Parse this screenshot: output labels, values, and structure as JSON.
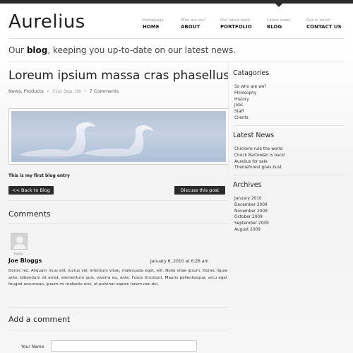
{
  "site": {
    "logo": "Aurelius"
  },
  "nav": [
    {
      "sub": "Homepage",
      "label": "HOME"
    },
    {
      "sub": "Who are we?",
      "label": "ABOUT"
    },
    {
      "sub": "Our latest work",
      "label": "PORTFOLIO"
    },
    {
      "sub": "Latest news",
      "label": "BLOG"
    },
    {
      "sub": "Get in touch",
      "label": "CONTACT US"
    }
  ],
  "tagline": {
    "pre": "Our ",
    "bold": "blog",
    "post": ", keeping you up-to-date on our latest news."
  },
  "post": {
    "title": "Loreum ipsium massa cras phasellus",
    "meta_categories": "News, Products",
    "meta_date": "31st Sep, 09",
    "meta_comments": "7 Comments",
    "entry_text": "This is my first blog entry",
    "back_label": "<< Back to Blog",
    "discuss_label": "Discuss this post"
  },
  "comments": {
    "heading": "Comments",
    "items": [
      {
        "reply": "Reply",
        "author": "Joe Bloggs",
        "date": "January 6, 2010 at 6:26 am",
        "body": "Donec leo. Aliquam risus elit, luctus vel, interdum vitae, malesuada eget, elit. Nulla vitae ipsum. Donec ligula ante, bibendum sit amet, elementum quis, viverra eu, ante. Fusce tincidunt. Mauris pellentesque, arcu eget feugiat accumsan, ipsum mi molestie orci, ut pulvinar sapien lorem nec dui."
      }
    ]
  },
  "add_comment": {
    "heading": "Add a comment",
    "name_label": "Your Name",
    "name_value": ""
  },
  "sidebar": {
    "categories": {
      "heading": "Catagories",
      "items": [
        "So who are we?",
        "Philosophy",
        "History",
        "Jobs",
        "Staff",
        "Clients"
      ]
    },
    "latest_news": {
      "heading": "Latest News",
      "items": [
        "Chickens rule the world",
        "Chuck Bartowski is back!",
        "Aurelius for sale",
        "Themeforest goes bust"
      ]
    },
    "archives": {
      "heading": "Archives",
      "items": [
        "January 2010",
        "December 2009",
        "November 2009",
        "October 2009",
        "September 2009",
        "August 2009"
      ]
    }
  },
  "colors": {
    "dark": "#2b2b2b",
    "text": "#333333",
    "muted": "#999999",
    "rule": "#e3e3e3"
  },
  "icons": {
    "avatar": "default-avatar-icon",
    "image": "swans-photo"
  }
}
